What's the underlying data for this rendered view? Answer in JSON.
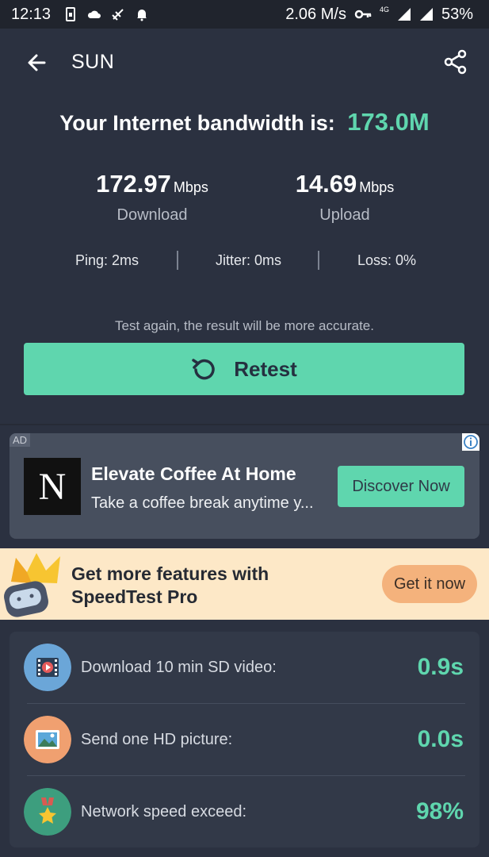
{
  "status_bar": {
    "time": "12:13",
    "net_speed": "2.06 M/s",
    "network_type": "4G",
    "battery": "53%"
  },
  "header": {
    "title": "SUN"
  },
  "result": {
    "bandwidth_label": "Your Internet bandwidth is:",
    "bandwidth_value": "173.0M",
    "download": {
      "value": "172.97",
      "unit": "Mbps",
      "label": "Download"
    },
    "upload": {
      "value": "14.69",
      "unit": "Mbps",
      "label": "Upload"
    },
    "ping": "Ping: 2ms",
    "jitter": "Jitter: 0ms",
    "loss": "Loss: 0%",
    "hint": "Test again, the result will be more accurate.",
    "retest_label": "Retest"
  },
  "ad": {
    "tag": "AD",
    "logo_letter": "N",
    "title": "Elevate Coffee At Home",
    "description": "Take a coffee break anytime y...",
    "cta": "Discover Now"
  },
  "promo": {
    "line1": "Get more features with",
    "line2": "SpeedTest Pro",
    "cta": "Get it now"
  },
  "performance": [
    {
      "label": "Download 10 min SD video:",
      "value": "0.9s",
      "icon": "video-icon"
    },
    {
      "label": "Send one HD picture:",
      "value": "0.0s",
      "icon": "picture-icon"
    },
    {
      "label": "Network speed exceed:",
      "value": "98%",
      "icon": "medal-icon"
    }
  ],
  "colors": {
    "accent": "#5fd6ae",
    "background": "#2b3140",
    "promo_background": "#fde8c7",
    "promo_button": "#f4b27c"
  }
}
